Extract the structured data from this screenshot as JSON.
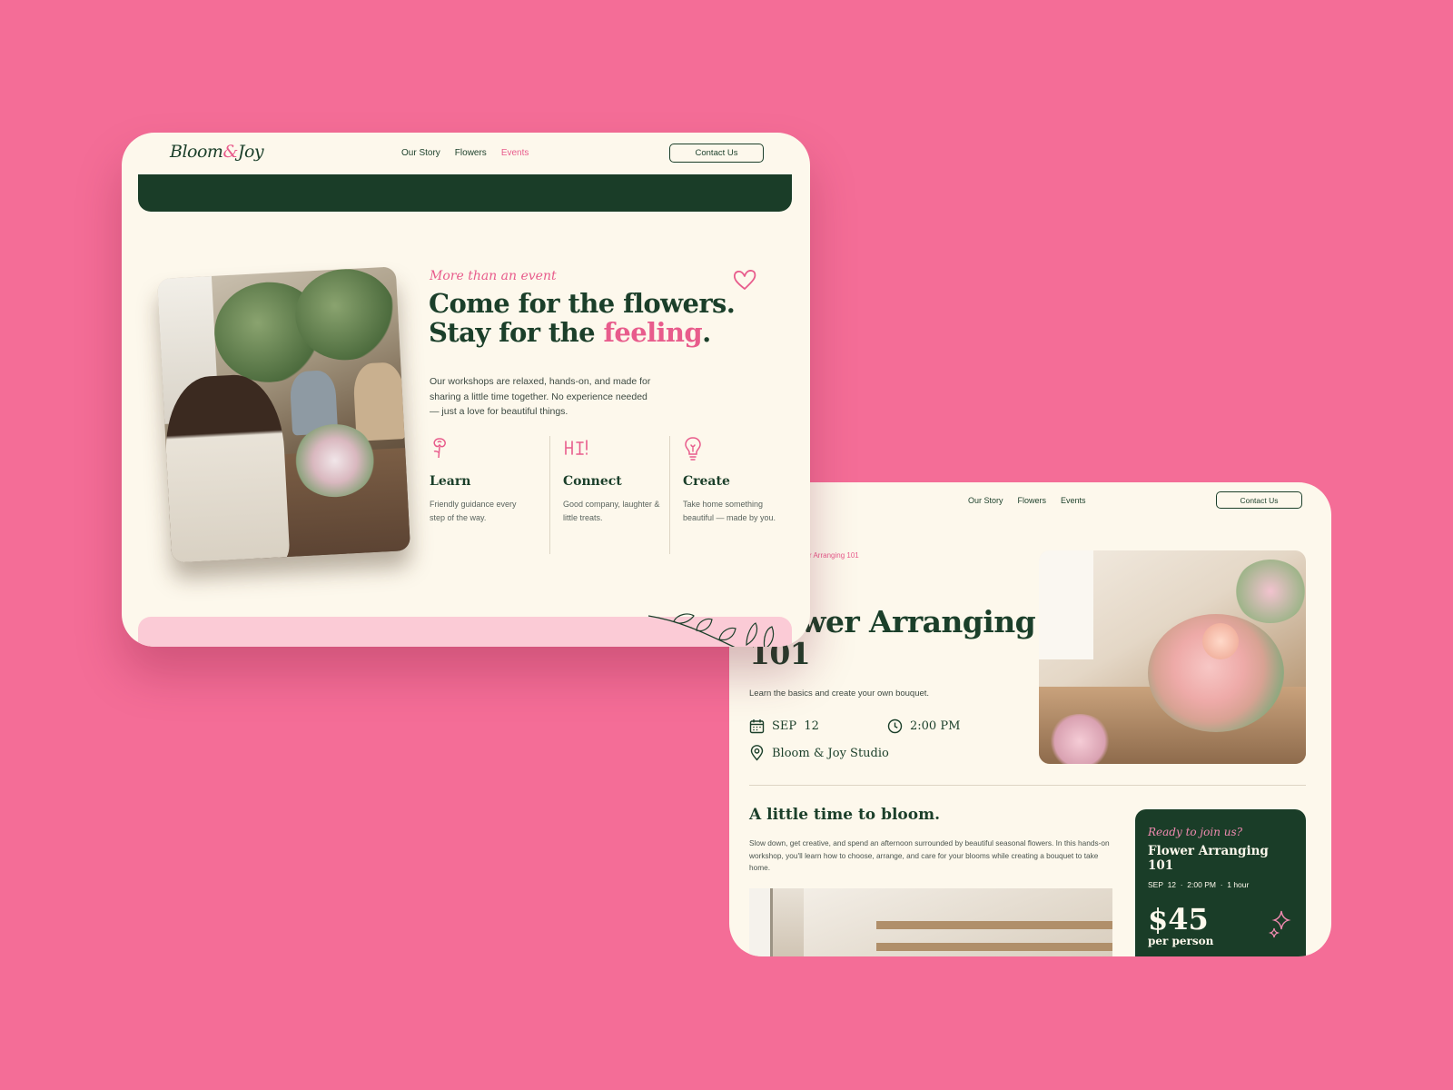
{
  "colors": {
    "background": "#f46d97",
    "cream": "#fdf8ec",
    "forest": "#1a3d28",
    "pink": "#e85c8c",
    "blush": "#fbcbd6"
  },
  "brand": {
    "name_a": "Bloom",
    "amp": "&",
    "name_b": "Joy"
  },
  "nav": {
    "links": [
      "Our Story",
      "Flowers",
      "Events"
    ],
    "active": "Events",
    "contact_label": "Contact Us"
  },
  "events_page": {
    "eyebrow": "More than an event",
    "title_line1": "Come for the flowers.",
    "title_line2_pre": "Stay for the ",
    "title_line2_accent": "feeling",
    "title_line2_post": ".",
    "description": "Our workshops are relaxed, hands-on, and made for sharing a little time together. No experience needed — just a love for beautiful things.",
    "features": [
      {
        "icon": "rose-icon",
        "title": "Learn",
        "text": "Friendly guidance every step of the way."
      },
      {
        "icon": "hi-icon",
        "title": "Connect",
        "text": "Good company, laughter & little treats."
      },
      {
        "icon": "lightbulb-icon",
        "title": "Create",
        "text": "Take home something beautiful — made by you."
      }
    ]
  },
  "detail_page": {
    "breadcrumb_sep": "/",
    "breadcrumb_current": "Flower Arranging 101",
    "title": "Flower Arranging 101",
    "subtitle": "Learn the basics and create your own bouquet.",
    "date": "SEP  12",
    "time": "2:00 PM",
    "location": "Bloom & Joy Studio",
    "section_title": "A little time to bloom.",
    "section_text": "Slow down, get creative, and spend an afternoon surrounded by beautiful seasonal flowers. In this hands-on workshop, you'll learn how to choose, arrange, and care for your blooms while creating a bouquet to take home.",
    "booking": {
      "eyebrow": "Ready to join us?",
      "title": "Flower Arranging 101",
      "meta": "SEP  12  ·  2:00 PM  ·  1 hour",
      "price": "$45",
      "per": "per person"
    }
  }
}
